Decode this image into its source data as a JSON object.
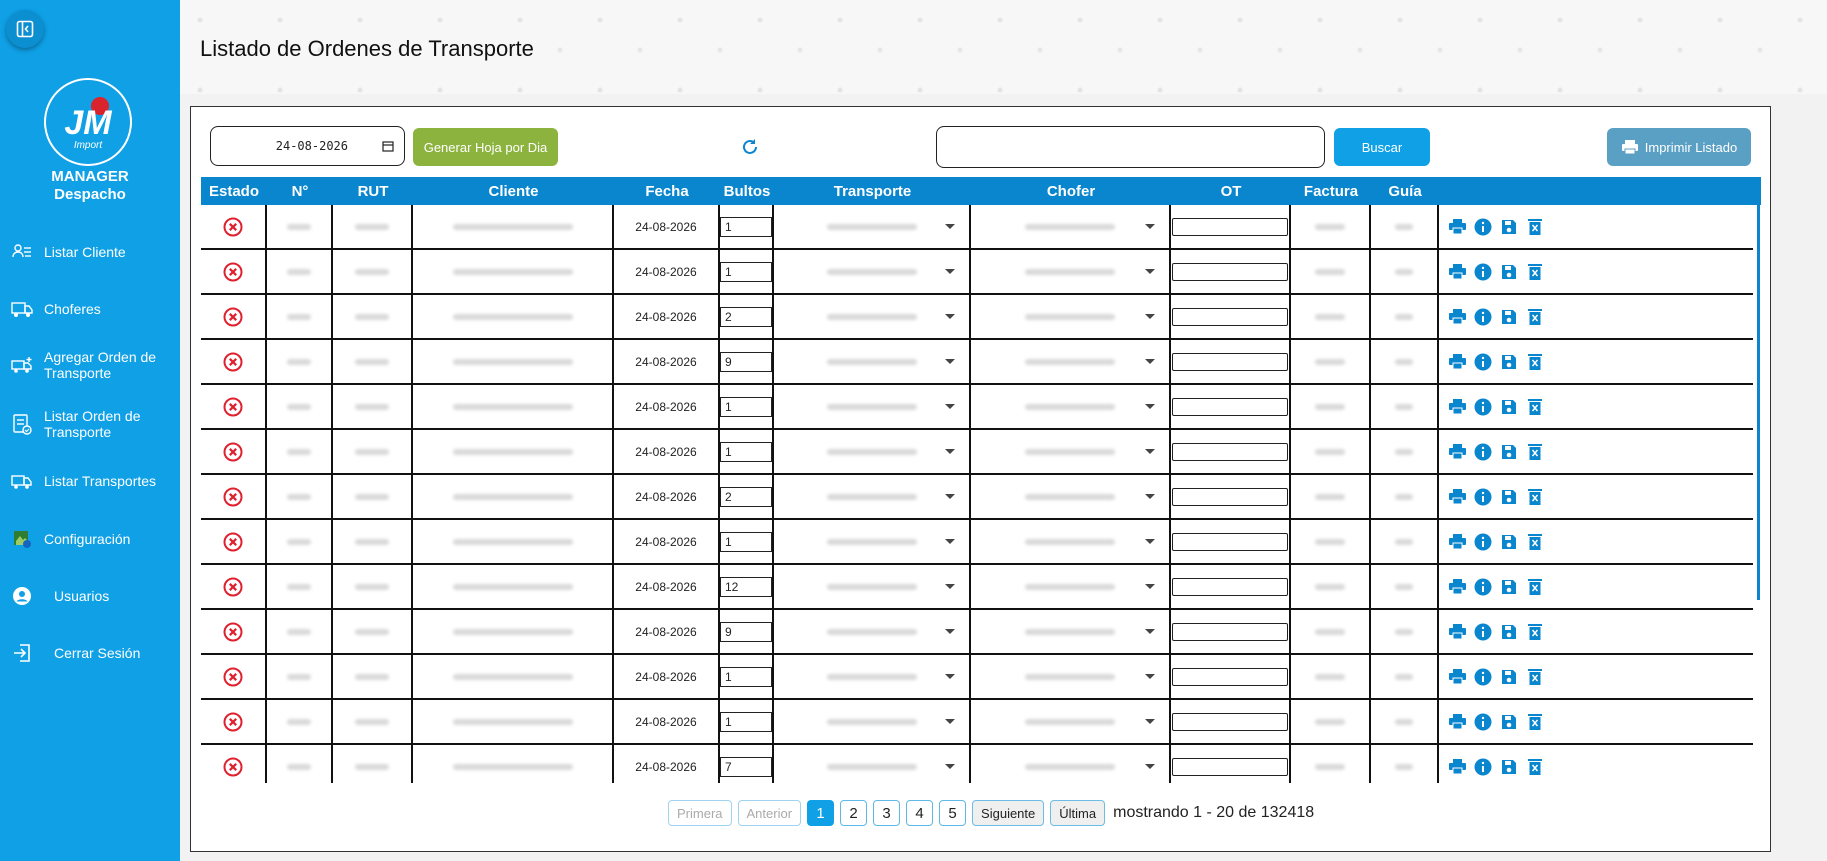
{
  "app": {
    "brand_line1": "MANAGER",
    "brand_line2": "Despacho",
    "logo_text": "JM",
    "logo_sub": "Import"
  },
  "sidebar": {
    "items": [
      {
        "label": "Listar Cliente",
        "icon": "client-list-icon"
      },
      {
        "label": "Choferes",
        "icon": "truck-icon"
      },
      {
        "label": "Agregar Orden de Transporte",
        "icon": "add-order-truck-icon"
      },
      {
        "label": "Listar Orden de Transporte",
        "icon": "order-list-icon"
      },
      {
        "label": "Listar Transportes",
        "icon": "transport-icon"
      },
      {
        "label": "Configuración",
        "icon": "settings-icon"
      },
      {
        "label": "Usuarios",
        "icon": "user-icon"
      },
      {
        "label": "Cerrar Sesión",
        "icon": "logout-icon"
      }
    ]
  },
  "header": {
    "title": "Listado de Ordenes de Transporte"
  },
  "toolbar": {
    "date_value": "24-08-2026",
    "generate_label": "Generar Hoja por Dia",
    "search_value": "",
    "search_label": "Buscar",
    "print_label": "Imprimir Listado"
  },
  "table": {
    "columns": [
      "Estado",
      "N°",
      "RUT",
      "Cliente",
      "Fecha",
      "Bultos",
      "Transporte",
      "Chofer",
      "OT",
      "Factura",
      "Guía"
    ],
    "rows": [
      {
        "fecha": "24-08-2026",
        "bultos": "1"
      },
      {
        "fecha": "24-08-2026",
        "bultos": "1"
      },
      {
        "fecha": "24-08-2026",
        "bultos": "2"
      },
      {
        "fecha": "24-08-2026",
        "bultos": "9"
      },
      {
        "fecha": "24-08-2026",
        "bultos": "1"
      },
      {
        "fecha": "24-08-2026",
        "bultos": "1"
      },
      {
        "fecha": "24-08-2026",
        "bultos": "2"
      },
      {
        "fecha": "24-08-2026",
        "bultos": "1"
      },
      {
        "fecha": "24-08-2026",
        "bultos": "12"
      },
      {
        "fecha": "24-08-2026",
        "bultos": "9"
      },
      {
        "fecha": "24-08-2026",
        "bultos": "1"
      },
      {
        "fecha": "24-08-2026",
        "bultos": "1"
      },
      {
        "fecha": "24-08-2026",
        "bultos": "7"
      }
    ]
  },
  "pagination": {
    "first": "Primera",
    "prev": "Anterior",
    "pages": [
      "1",
      "2",
      "3",
      "4",
      "5"
    ],
    "current": "1",
    "next": "Siguiente",
    "last": "Última",
    "info": "mostrando 1 - 20 de 132418"
  },
  "colors": {
    "primary": "#0fa0e6",
    "header_row": "#0a86cf",
    "green": "#8db33f",
    "print": "#5a9fc4",
    "danger": "#e0202e"
  }
}
